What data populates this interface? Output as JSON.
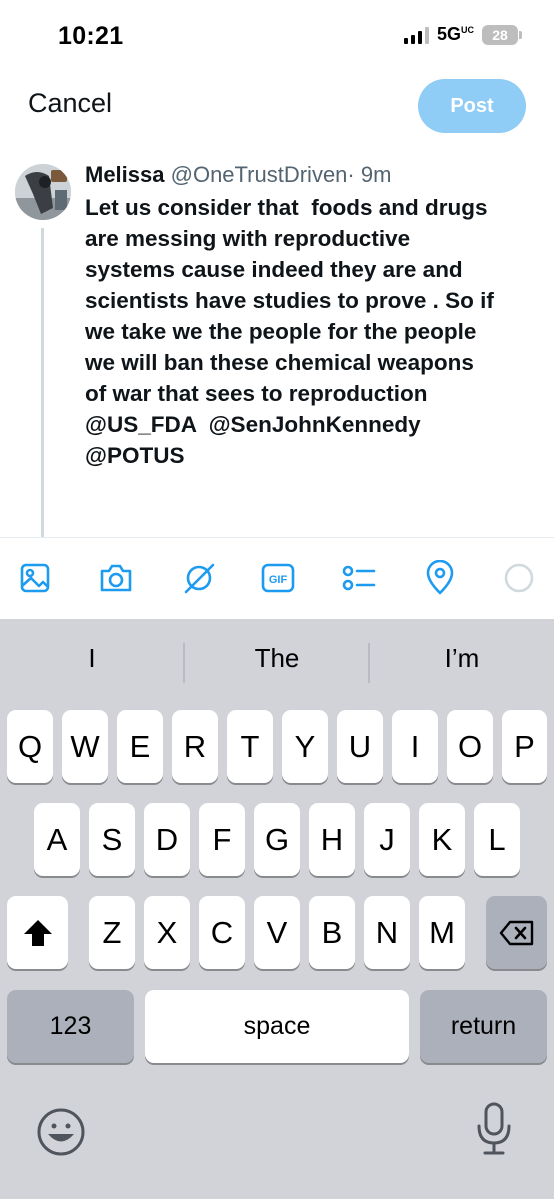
{
  "status_bar": {
    "time": "10:21",
    "network": "5G",
    "network_badge": "UC",
    "battery": "28"
  },
  "header": {
    "cancel_label": "Cancel",
    "post_label": "Post",
    "post_color": "#8fccf6"
  },
  "tweet": {
    "name": "Melissa",
    "handle": "@OneTrustDriven",
    "time_meta": "· 9m",
    "text": "Let us consider that  foods and drugs\nare messing with reproductive\nsystems cause indeed they are and\nscientists have studies to prove . So if\nwe take we the people for the people\nwe will ban these chemical weapons\nof war that sees to reproduction\n@US_FDA  @SenJohnKennedy\n@POTUS"
  },
  "toolbar": {
    "icons": [
      "image-icon",
      "camera-icon",
      "grok-icon",
      "gif-icon",
      "poll-icon",
      "location-icon",
      "character-count-icon"
    ],
    "gif_label": "GIF",
    "accent": "#1d9bf0"
  },
  "keyboard": {
    "suggestions": [
      "I",
      "The",
      "I’m"
    ],
    "row1": [
      "Q",
      "W",
      "E",
      "R",
      "T",
      "Y",
      "U",
      "I",
      "O",
      "P"
    ],
    "row2": [
      "A",
      "S",
      "D",
      "F",
      "G",
      "H",
      "J",
      "K",
      "L"
    ],
    "row3": [
      "Z",
      "X",
      "C",
      "V",
      "B",
      "N",
      "M"
    ],
    "numbers_label": "123",
    "space_label": "space",
    "return_label": "return"
  }
}
